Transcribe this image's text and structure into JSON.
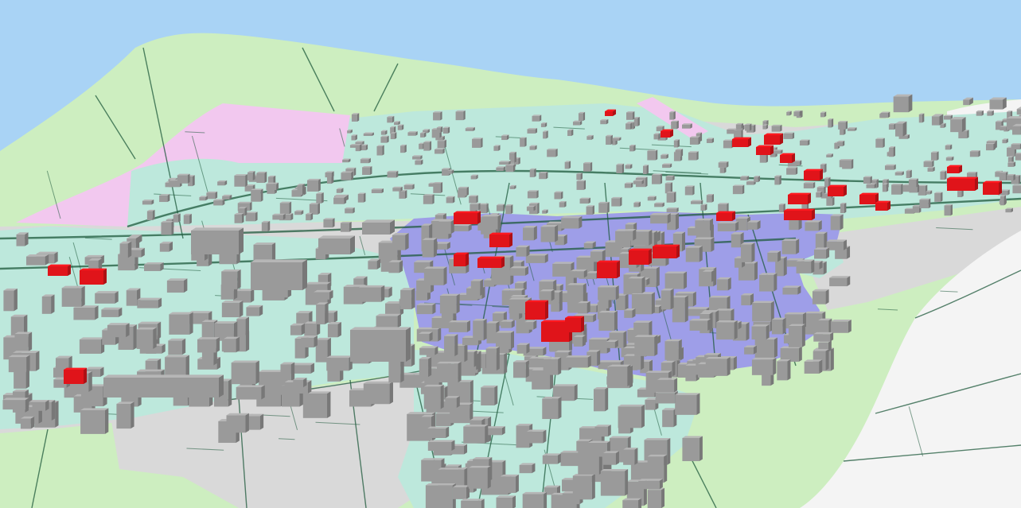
{
  "map": {
    "view": "3d-perspective-zoning-map",
    "colors": {
      "sky": "#a9d3f5",
      "hillside_green": "#cdeec0",
      "residential_teal": "#bde8dc",
      "core_blue": "#9e9ee8",
      "industrial_pink": "#f2c8ef",
      "gray_zone": "#d9d9d9",
      "river_white": "#f4f4f4",
      "building_gray": "#9a9a9a",
      "building_red": "#e0141a",
      "road_line": "#1f5a3c"
    },
    "legend_visible": false
  }
}
